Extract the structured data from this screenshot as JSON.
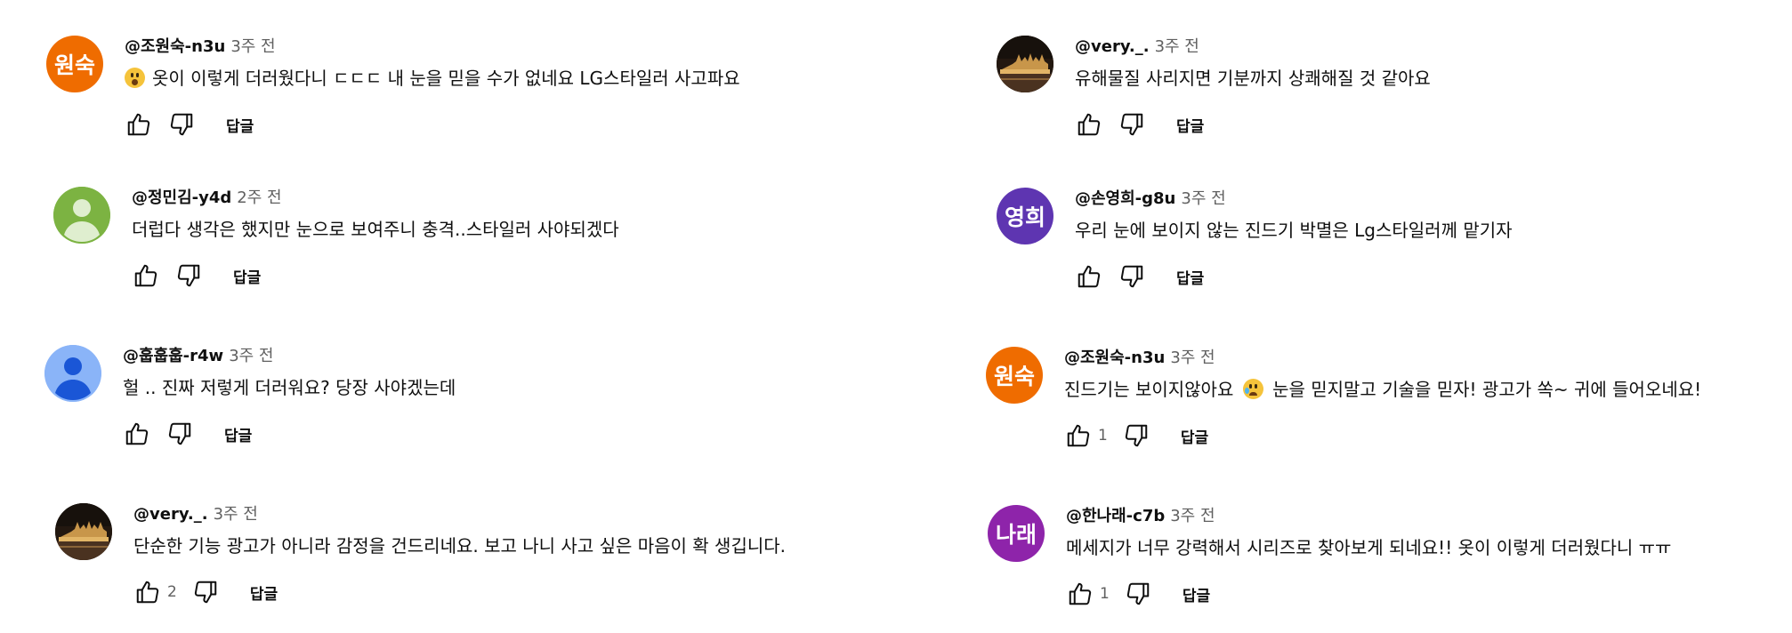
{
  "colors": {
    "avatar_orange": "#ef6c00",
    "avatar_green": "#7cb342",
    "avatar_blue": "#8ab4f8",
    "avatar_purple": "#5e35b1",
    "avatar_violet": "#8e24aa",
    "meta_gray": "#606060"
  },
  "icons": {
    "like": "thumbs-up-icon",
    "dislike": "thumbs-down-icon"
  },
  "left_column": [
    {
      "avatar": {
        "type": "initials",
        "initials": "원숙",
        "color": "#ef6c00"
      },
      "author": "@조원숙-n3u",
      "time": "3주 전",
      "emoji": "surprised-face",
      "text": "옷이 이렇게 더러웠다니 ㄷㄷㄷ 내 눈을 믿을 수가 없네요  LG스타일러 사고파요",
      "likes": "",
      "reply_label": "답글"
    },
    {
      "avatar": {
        "type": "default-person",
        "color": "#7cb342"
      },
      "author": "@정민김-y4d",
      "time": "2주 전",
      "text": "더럽다 생각은 했지만 눈으로 보여주니 충격..스타일러 사야되겠다",
      "likes": "",
      "reply_label": "답글"
    },
    {
      "avatar": {
        "type": "default-person",
        "color": "#8ab4f8"
      },
      "author": "@훕훕훕-r4w",
      "time": "3주 전",
      "text": "헐 .. 진짜 저렇게 더러워요? 당장 사야겠는데",
      "likes": "",
      "reply_label": "답글"
    },
    {
      "avatar": {
        "type": "photo-night-building"
      },
      "author": "@very._.",
      "time": "3주 전",
      "text": "단순한 기능 광고가 아니라 감정을 건드리네요. 보고 나니 사고 싶은 마음이 확 생깁니다.",
      "likes": "2",
      "reply_label": "답글"
    }
  ],
  "right_column": [
    {
      "avatar": {
        "type": "photo-night-building"
      },
      "author": "@very._.",
      "time": "3주 전",
      "text": "유해물질 사리지면 기분까지 상쾌해질 것 같아요",
      "likes": "",
      "reply_label": "답글"
    },
    {
      "avatar": {
        "type": "initials",
        "initials": "영희",
        "color": "#5e35b1"
      },
      "author": "@손영희-g8u",
      "time": "3주 전",
      "text": "우리 눈에 보이지 않는 진드기 박멸은 Lg스타일러께 맡기자",
      "likes": "",
      "reply_label": "답글"
    },
    {
      "avatar": {
        "type": "initials",
        "initials": "원숙",
        "color": "#ef6c00"
      },
      "author": "@조원숙-n3u",
      "time": "3주 전",
      "text_before_emoji": "진드기는 보이지않아요",
      "emoji": "crying-face",
      "text": "눈을 믿지말고 기술을 믿자!  광고가 쏙~ 귀에 들어오네요!",
      "likes": "1",
      "reply_label": "답글"
    },
    {
      "avatar": {
        "type": "initials",
        "initials": "나래",
        "color": "#8e24aa"
      },
      "author": "@한나래-c7b",
      "time": "3주 전",
      "text": "메세지가 너무 강력해서 시리즈로 찾아보게 되네요!! 옷이 이렇게 더러웠다니 ㅠㅠ",
      "likes": "1",
      "reply_label": "답글"
    }
  ]
}
